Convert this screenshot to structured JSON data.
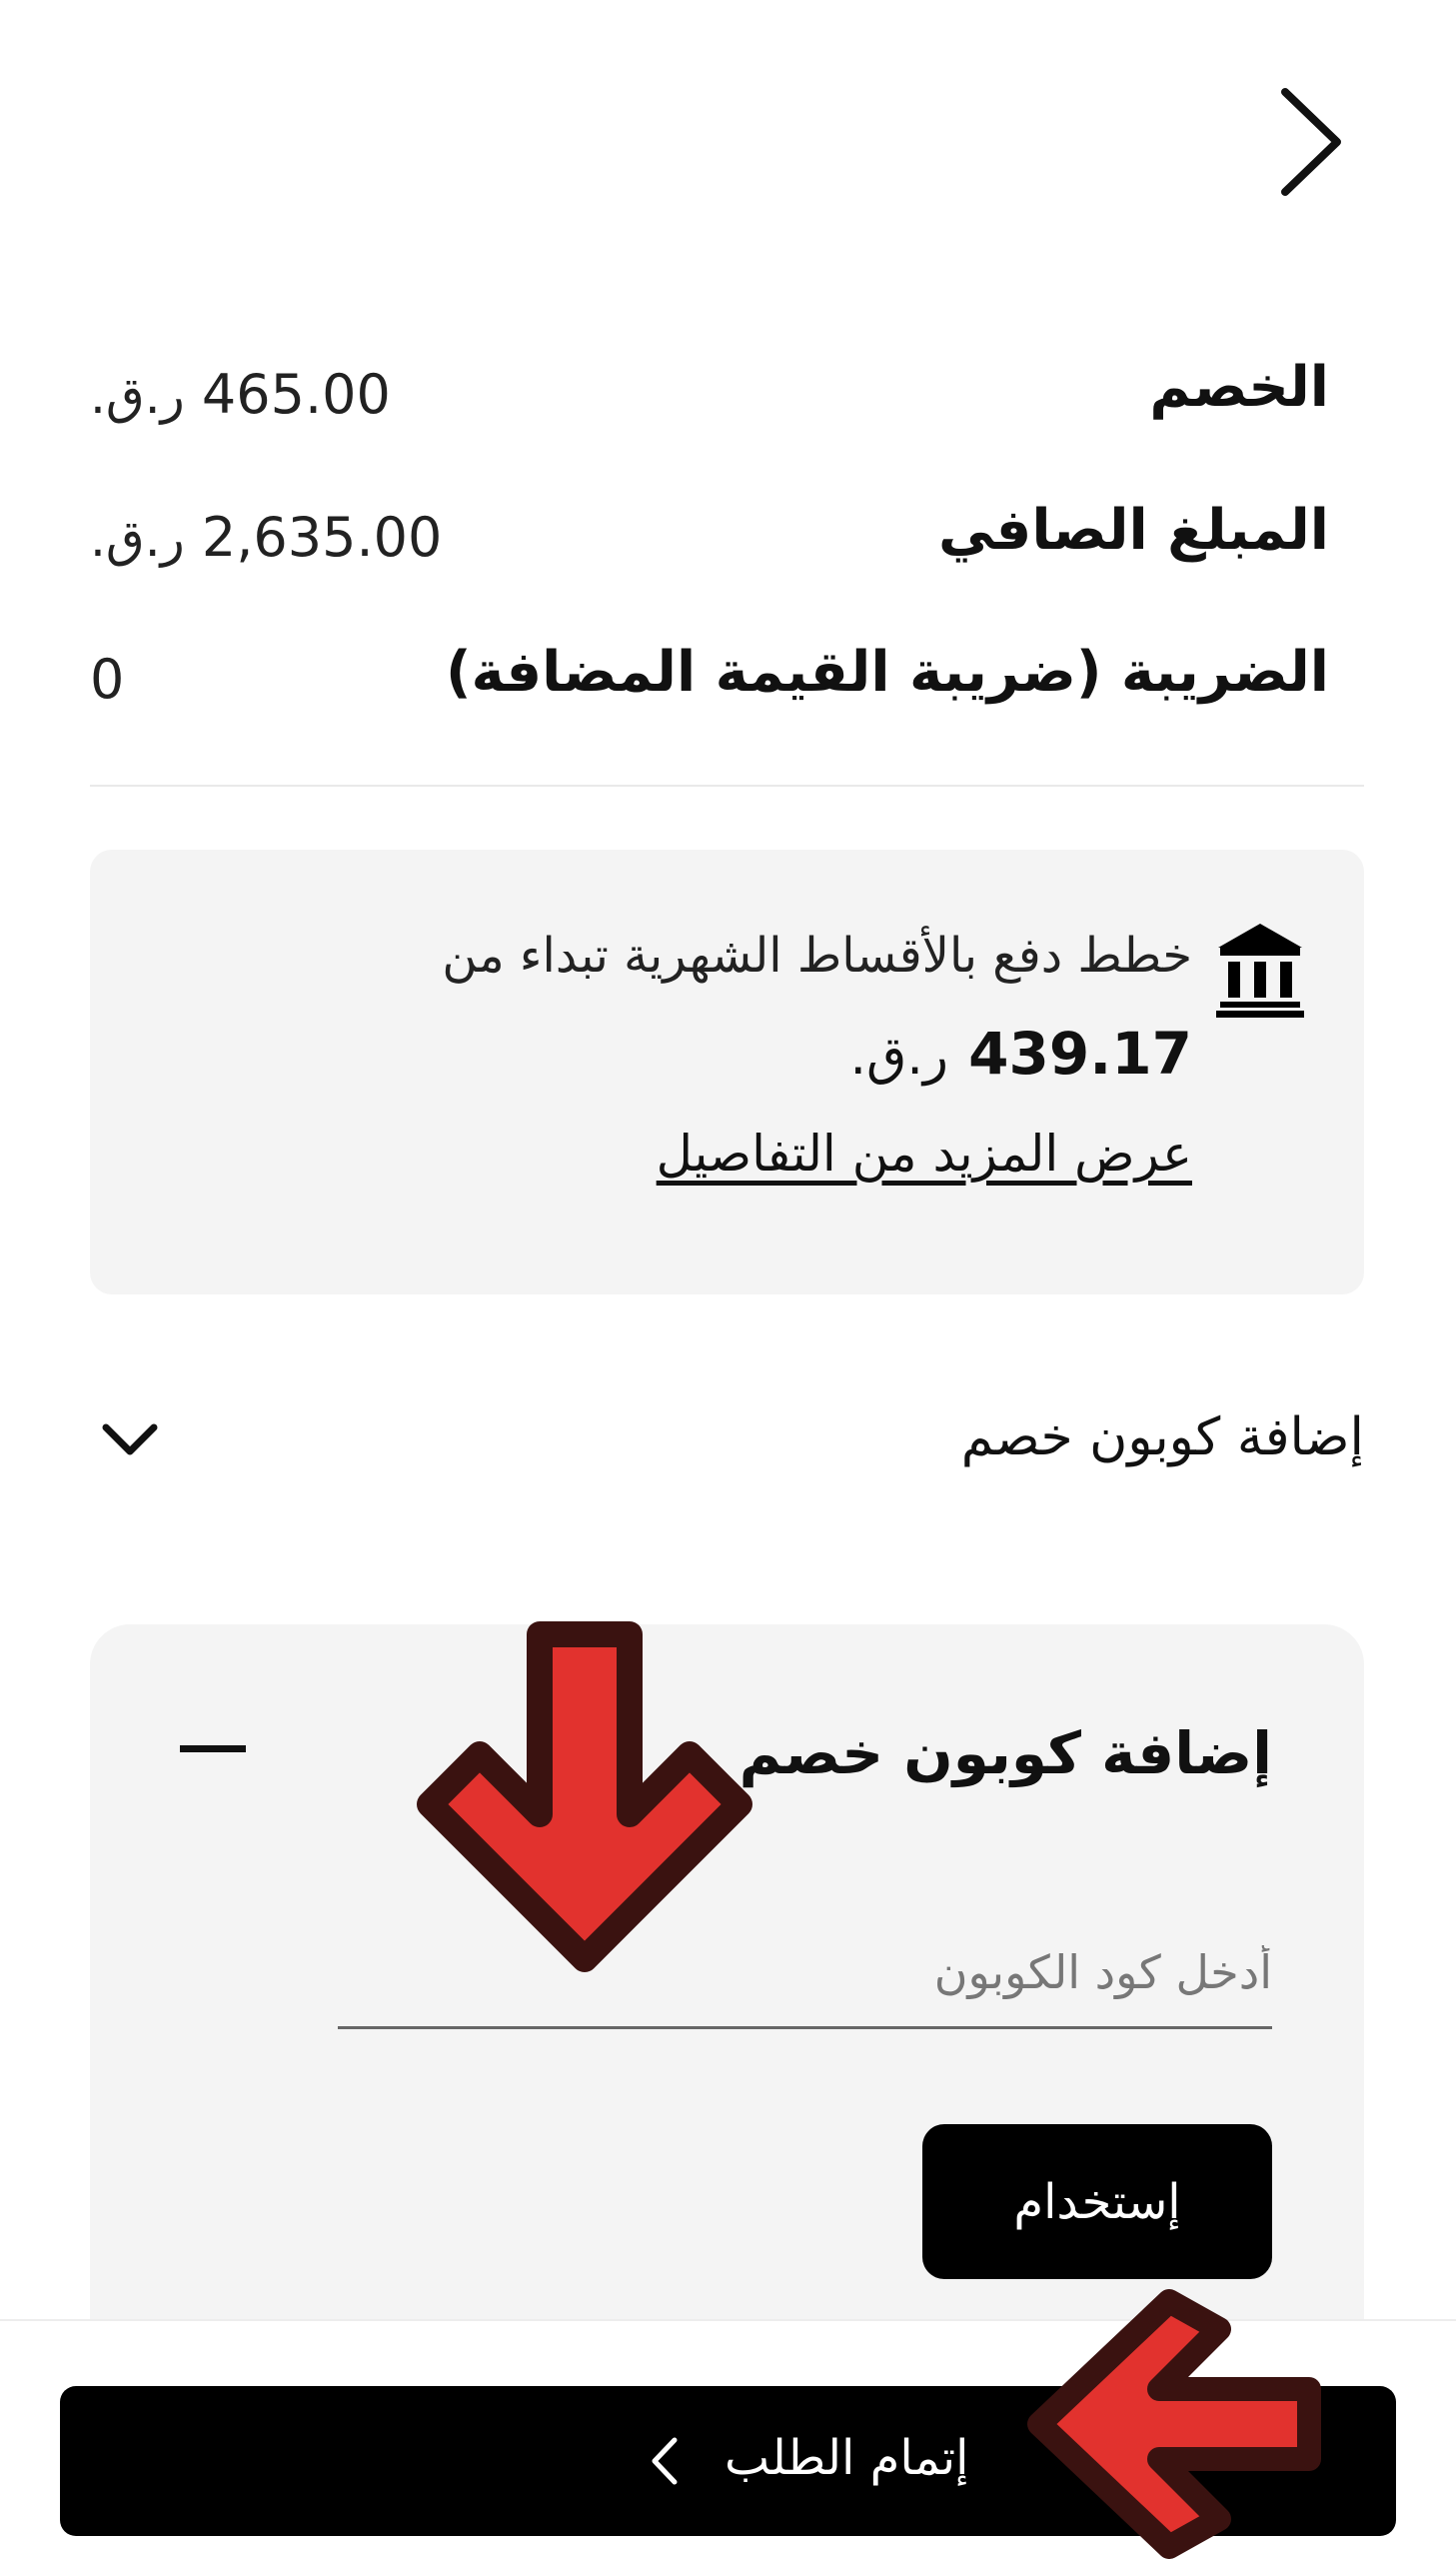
{
  "header": {
    "back_icon": "chevron-right-icon"
  },
  "summary": {
    "rows": [
      {
        "label": "الخصم",
        "amount": "465.00",
        "currency": "ر.ق."
      },
      {
        "label": "المبلغ الصافي",
        "amount": "2,635.00",
        "currency": "ر.ق."
      },
      {
        "label": "الضريبة (ضريبة القيمة المضافة)",
        "amount": "0",
        "currency": ""
      }
    ]
  },
  "installments": {
    "icon": "bank-icon",
    "text": "خطط دفع بالأقساط الشهرية تبداء من",
    "amount": "439.17",
    "currency": "ر.ق.",
    "details_link": "عرض المزيد من التفاصيل"
  },
  "coupon_toggle": {
    "label": "إضافة كوبون خصم",
    "icon": "chevron-down-icon"
  },
  "coupon_panel": {
    "title": "إضافة كوبون خصم",
    "collapse_icon": "minus-icon",
    "input_placeholder": "أدخل كود الكوبون",
    "input_value": "",
    "apply_label": "إستخدام"
  },
  "checkout": {
    "label": "إتمام الطلب",
    "icon": "chevron-left-icon"
  },
  "annotations": {
    "arrow_color": "#e2322e",
    "arrow_outline_color": "#3a1210"
  }
}
